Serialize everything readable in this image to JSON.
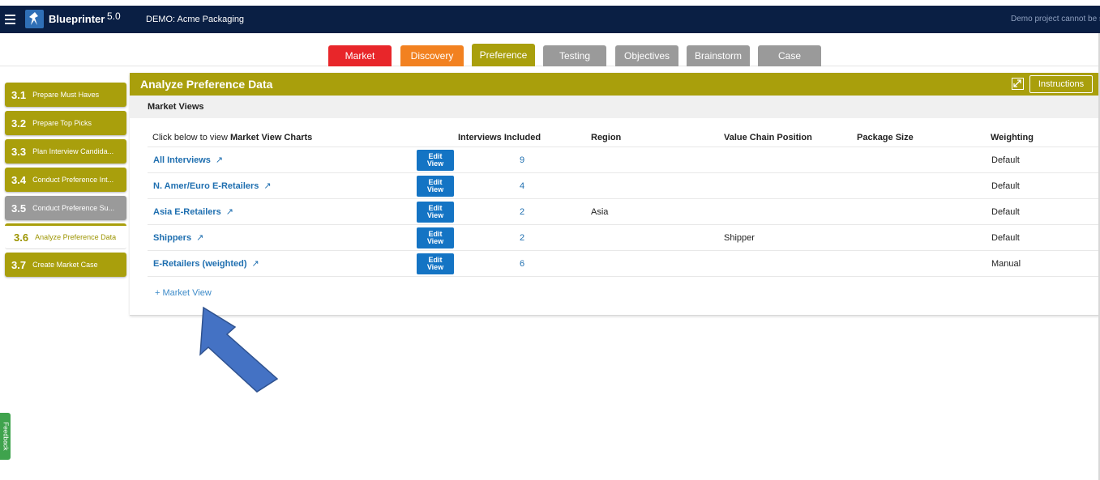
{
  "header": {
    "app_name": "Blueprinter",
    "app_version": "5.0",
    "project": "DEMO: Acme Packaging",
    "notice": "Demo project cannot be s"
  },
  "tabs": [
    {
      "label": "Market",
      "color": "#e8262a"
    },
    {
      "label": "Discovery",
      "color": "#f28120"
    },
    {
      "label": "Preference",
      "color": "#a99f0c",
      "active": true
    },
    {
      "label": "Testing",
      "color": "#9a9a9a"
    },
    {
      "label": "Objectives",
      "color": "#9a9a9a"
    },
    {
      "label": "Brainstorm",
      "color": "#9a9a9a"
    },
    {
      "label": "Case",
      "color": "#9a9a9a"
    }
  ],
  "sidebar": {
    "steps": [
      {
        "num": "3.1",
        "label": "Prepare Must Haves"
      },
      {
        "num": "3.2",
        "label": "Prepare Top Picks"
      },
      {
        "num": "3.3",
        "label": "Plan Interview Candida..."
      },
      {
        "num": "3.4",
        "label": "Conduct Preference Int..."
      },
      {
        "num": "3.5",
        "label": "Conduct Preference Su..."
      },
      {
        "num": "3.6",
        "label": "Analyze Preference Data"
      },
      {
        "num": "3.7",
        "label": "Create Market Case"
      }
    ]
  },
  "panel": {
    "title": "Analyze Preference Data",
    "instructions_label": "Instructions",
    "section_label": "Market Views",
    "intro_prefix": "Click below to view ",
    "intro_bold": "Market View Charts",
    "columns": {
      "interviews": "Interviews Included",
      "region": "Region",
      "vcp": "Value Chain Position",
      "package": "Package Size",
      "weighting": "Weighting"
    },
    "edit_line1": "Edit",
    "edit_line2": "View",
    "arrow_glyph": "↗",
    "rows": [
      {
        "name": "All Interviews",
        "count": "9",
        "region": "",
        "vcp": "",
        "package": "",
        "weighting": "Default"
      },
      {
        "name": "N. Amer/Euro E-Retailers",
        "count": "4",
        "region": "",
        "vcp": "",
        "package": "",
        "weighting": "Default"
      },
      {
        "name": "Asia E-Retailers",
        "count": "2",
        "region": "Asia",
        "vcp": "",
        "package": "",
        "weighting": "Default"
      },
      {
        "name": "Shippers",
        "count": "2",
        "region": "",
        "vcp": "Shipper",
        "package": "",
        "weighting": "Default"
      },
      {
        "name": "E-Retailers (weighted)",
        "count": "6",
        "region": "",
        "vcp": "",
        "package": "",
        "weighting": "Manual"
      }
    ],
    "add_view_label": "+ Market View"
  },
  "feedback_label": "Feedback",
  "colors": {
    "topbar": "#0a1f44",
    "accent": "#a99f0c",
    "link": "#1f6fb0",
    "edit_button": "#1474c4",
    "step_inactive": "#9a9a9a",
    "annotation_arrow": "#4472c4"
  }
}
